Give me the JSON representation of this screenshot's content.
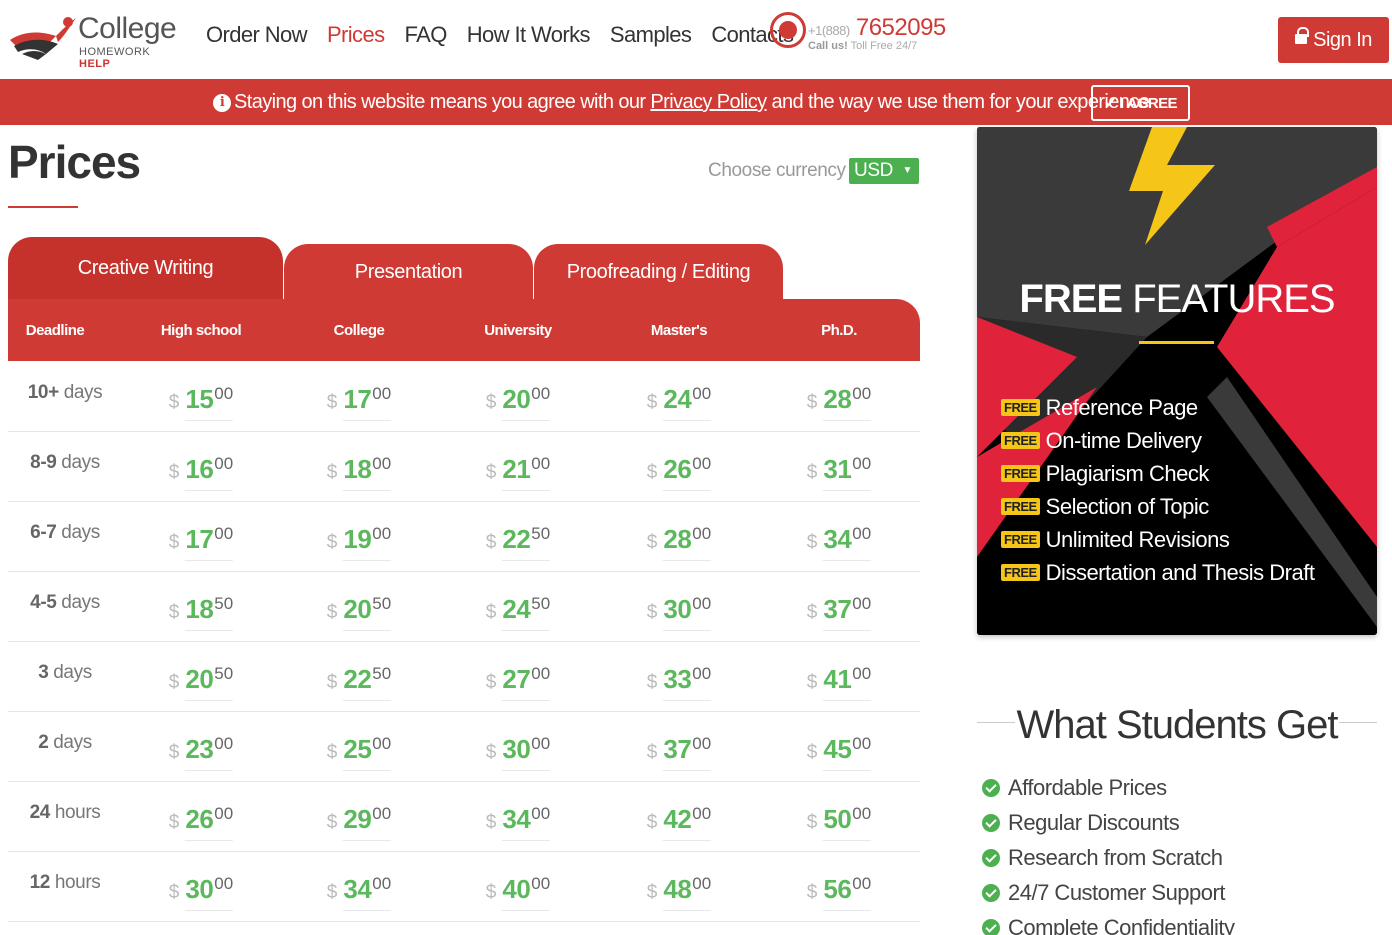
{
  "header": {
    "logo_word": "College",
    "logo_sub": "HOMEWORK",
    "logo_sub_accent": "HELP",
    "nav": [
      "Order Now",
      "Prices",
      "FAQ",
      "How It Works",
      "Samples",
      "Contacts"
    ],
    "active_nav": "Prices",
    "phone_prefix": "+1(888)",
    "phone_number": "7652095",
    "call_label": "Call us!",
    "call_sub": "Toll Free 24/7",
    "signin_label": "Sign In"
  },
  "banner": {
    "text_before": "Staying on this website means you agree with our",
    "link": "Privacy Policy",
    "text_after": "and the way we use them for your experience",
    "agree_label": "I AGREE"
  },
  "page": {
    "title": "Prices",
    "currency_label": "Choose currency",
    "currency_value": "USD"
  },
  "tabs": [
    "Creative Writing",
    "Presentation",
    "Proofreading / Editing"
  ],
  "table": {
    "columns": [
      "Deadline",
      "High school",
      "College",
      "University",
      "Master's",
      "Ph.D."
    ],
    "currency_symbol": "$",
    "rows": [
      {
        "num": "10+",
        "unit": "days",
        "prices": [
          [
            "15",
            "00"
          ],
          [
            "17",
            "00"
          ],
          [
            "20",
            "00"
          ],
          [
            "24",
            "00"
          ],
          [
            "28",
            "00"
          ]
        ]
      },
      {
        "num": "8-9",
        "unit": "days",
        "prices": [
          [
            "16",
            "00"
          ],
          [
            "18",
            "00"
          ],
          [
            "21",
            "00"
          ],
          [
            "26",
            "00"
          ],
          [
            "31",
            "00"
          ]
        ]
      },
      {
        "num": "6-7",
        "unit": "days",
        "prices": [
          [
            "17",
            "00"
          ],
          [
            "19",
            "00"
          ],
          [
            "22",
            "50"
          ],
          [
            "28",
            "00"
          ],
          [
            "34",
            "00"
          ]
        ]
      },
      {
        "num": "4-5",
        "unit": "days",
        "prices": [
          [
            "18",
            "50"
          ],
          [
            "20",
            "50"
          ],
          [
            "24",
            "50"
          ],
          [
            "30",
            "00"
          ],
          [
            "37",
            "00"
          ]
        ]
      },
      {
        "num": "3",
        "unit": "days",
        "prices": [
          [
            "20",
            "50"
          ],
          [
            "22",
            "50"
          ],
          [
            "27",
            "00"
          ],
          [
            "33",
            "00"
          ],
          [
            "41",
            "00"
          ]
        ]
      },
      {
        "num": "2",
        "unit": "days",
        "prices": [
          [
            "23",
            "00"
          ],
          [
            "25",
            "00"
          ],
          [
            "30",
            "00"
          ],
          [
            "37",
            "00"
          ],
          [
            "45",
            "00"
          ]
        ]
      },
      {
        "num": "24",
        "unit": "hours",
        "prices": [
          [
            "26",
            "00"
          ],
          [
            "29",
            "00"
          ],
          [
            "34",
            "00"
          ],
          [
            "42",
            "00"
          ],
          [
            "50",
            "00"
          ]
        ]
      },
      {
        "num": "12",
        "unit": "hours",
        "prices": [
          [
            "30",
            "00"
          ],
          [
            "34",
            "00"
          ],
          [
            "40",
            "00"
          ],
          [
            "48",
            "00"
          ],
          [
            "56",
            "00"
          ]
        ]
      }
    ]
  },
  "free_features": {
    "title_bold": "FREE",
    "title_rest": "FEATURES",
    "badge": "FREE",
    "items": [
      "Reference Page",
      "On-time Delivery",
      "Plagiarism Check",
      "Selection of Topic",
      "Unlimited Revisions",
      "Dissertation and Thesis Draft"
    ]
  },
  "students": {
    "title": "What Students Get",
    "items": [
      "Affordable Prices",
      "Regular Discounts",
      "Research from Scratch",
      "24/7 Customer Support",
      "Complete Confidentiality"
    ]
  },
  "colors": {
    "accent": "#d03a34",
    "price_green": "#5cb85c",
    "currency_green": "#4caf50",
    "badge_yellow": "#f5c518"
  }
}
